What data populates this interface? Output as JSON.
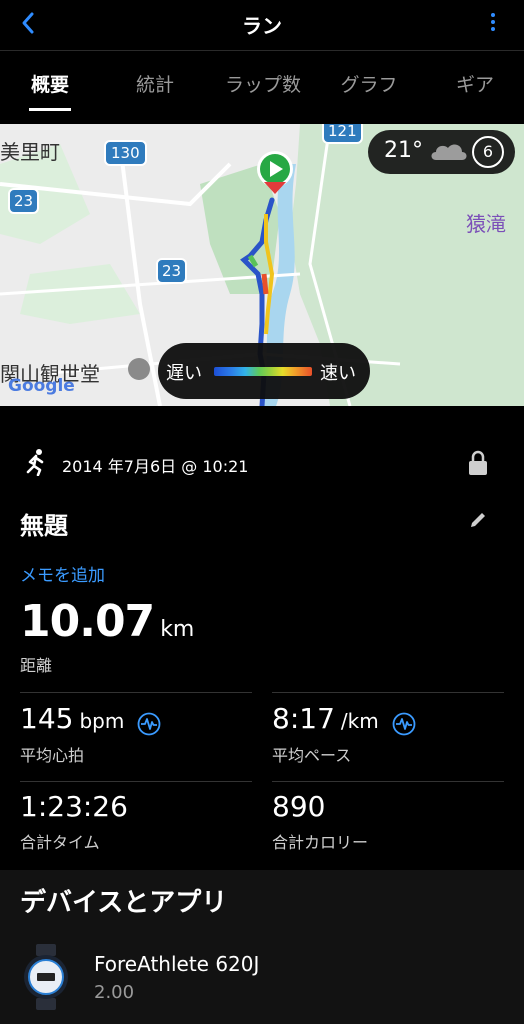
{
  "header": {
    "title": "ラン"
  },
  "tabs": [
    {
      "label": "概要",
      "active": true
    },
    {
      "label": "統計"
    },
    {
      "label": "ラップ数"
    },
    {
      "label": "グラフ"
    },
    {
      "label": "ギア"
    }
  ],
  "map": {
    "labels": {
      "place1": "美里町",
      "place2": "関山観世堂",
      "place3": "猿滝",
      "route130": "130",
      "route23a": "23",
      "route23b": "23",
      "route121": "121",
      "provider": "Google"
    },
    "weather": {
      "temp": "21°",
      "wind": "6"
    },
    "speed_legend": {
      "slow": "遅い",
      "fast": "速い"
    }
  },
  "activity": {
    "date": "2014 年7月6日 @ 10:21",
    "name": "無題",
    "memo_link": "メモを追加",
    "distance": {
      "value": "10.07",
      "unit": "km",
      "label": "距離"
    },
    "stats": {
      "heart": {
        "value": "145",
        "unit": "bpm",
        "label": "平均心拍"
      },
      "pace": {
        "value": "8:17",
        "unit": "/km",
        "label": "平均ペース"
      },
      "time": {
        "value": "1:23:26",
        "label": "合計タイム"
      },
      "calories": {
        "value": "890",
        "label": "合計カロリー"
      }
    }
  },
  "devices": {
    "header": "デバイスとアプリ",
    "device_name": "ForeAthlete 620J",
    "device_version": "2.00"
  },
  "colors": {
    "accent": "#2f8cff",
    "start_marker": "#27a844"
  }
}
